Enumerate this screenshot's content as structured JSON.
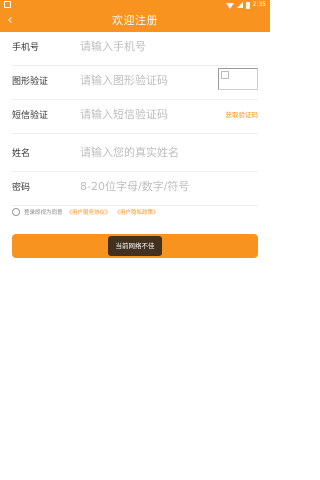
{
  "status_bar": {
    "time": "2:35",
    "left_icon": "notification-icon",
    "wifi_icon": "wifi-icon",
    "signal_icon": "signal-icon",
    "battery_icon": "battery-icon"
  },
  "header": {
    "title": "欢迎注册",
    "back_icon": "back-arrow-icon",
    "back_glyph": "‹"
  },
  "form": {
    "phone": {
      "label": "手机号",
      "placeholder": "请输入手机号",
      "value": ""
    },
    "captcha": {
      "label": "图形验证",
      "placeholder": "请输入图形验证码",
      "value": ""
    },
    "sms": {
      "label": "短信验证",
      "placeholder": "请输入短信验证码",
      "value": "",
      "get_code_label": "获取验证码"
    },
    "name": {
      "label": "姓名",
      "placeholder": "请输入您的真实姓名",
      "value": ""
    },
    "password": {
      "label": "密码",
      "placeholder": "8-20位字母/数字/符号",
      "value": ""
    }
  },
  "agreement": {
    "prefix": "登录即视为同意",
    "user_service": "《用户服务协议》",
    "privacy": "《用户隐私政策》"
  },
  "submit": {
    "label": ""
  },
  "toast": {
    "text": "当前网络不佳"
  },
  "colors": {
    "accent": "#f7931e",
    "placeholder": "#bdbdbd",
    "divider": "#eeeeee"
  }
}
